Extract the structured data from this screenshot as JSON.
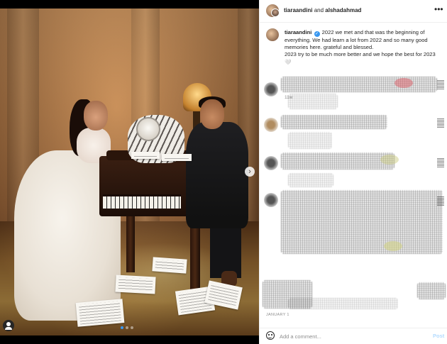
{
  "header": {
    "user1": "tiaraandini",
    "joiner": "and",
    "user2": "alshadahmad",
    "more_icon": "more-horizontal-icon"
  },
  "caption": {
    "username": "tiaraandini",
    "verified_icon": "verified-badge-icon",
    "text": "2022 we met and that was the beginning of everything. We had learn a lot from 2022 and so many good memories here. grateful and blessed.",
    "text2": "2023 try to be much more better and we hope the best for 2023",
    "emoji": "🤍",
    "time": "11w"
  },
  "post": {
    "date": "JANUARY 1",
    "comment_placeholder": "Add a comment...",
    "post_label": "Post",
    "carousel_dots": 3,
    "active_dot": 0
  },
  "colors": {
    "link": "#3897f0",
    "post_disabled": "#b3dbff",
    "muted": "#8e8e8e"
  }
}
